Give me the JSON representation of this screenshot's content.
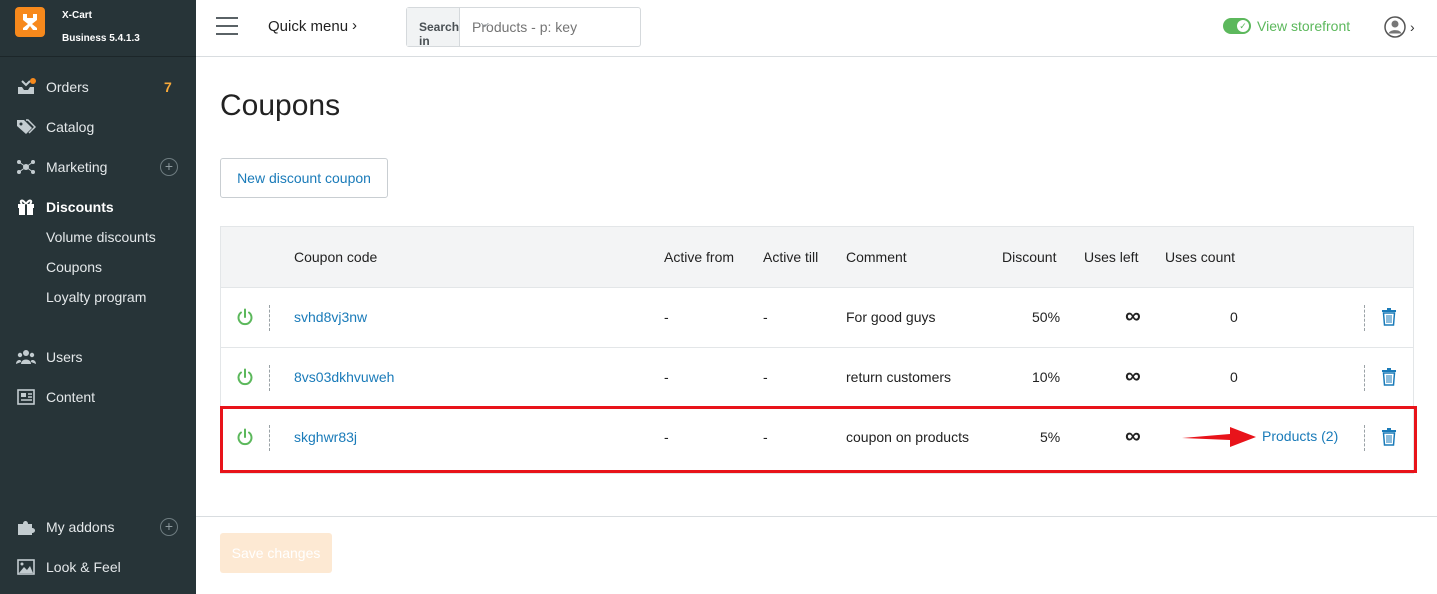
{
  "brand": {
    "name": "X-Cart",
    "version": "Business 5.4.1.3"
  },
  "sidebar": {
    "items": [
      {
        "label": "Orders",
        "badge": "7"
      },
      {
        "label": "Catalog"
      },
      {
        "label": "Marketing",
        "plus": "+"
      },
      {
        "label": "Discounts"
      },
      {
        "label": "Users"
      },
      {
        "label": "Content"
      },
      {
        "label": "My addons",
        "plus": "+"
      },
      {
        "label": "Look & Feel"
      }
    ],
    "sub_items": [
      {
        "label": "Volume discounts"
      },
      {
        "label": "Coupons"
      },
      {
        "label": "Loyalty program"
      }
    ]
  },
  "header": {
    "quick_menu": "Quick menu",
    "quick_menu_chevron": "›",
    "search_in": "Search in",
    "search_in_chevron": "⌵",
    "search_placeholder": "Products - p: key",
    "storefront": "View storefront",
    "user_chevron": "›"
  },
  "page": {
    "title": "Coupons",
    "new_button": "New discount coupon",
    "save_button": "Save changes"
  },
  "table": {
    "columns": [
      "Coupon code",
      "Active from",
      "Active till",
      "Comment",
      "Discount",
      "Uses left",
      "Uses count"
    ],
    "rows": [
      {
        "code": "svhd8vj3nw",
        "active_from": "-",
        "active_till": "-",
        "comment": "For good guys",
        "discount": "50%",
        "uses_left": "∞",
        "uses_count": "0"
      },
      {
        "code": "8vs03dkhvuweh",
        "active_from": "-",
        "active_till": "-",
        "comment": "return customers",
        "discount": "10%",
        "uses_left": "∞",
        "uses_count": "0"
      },
      {
        "code": "skghwr83j",
        "active_from": "-",
        "active_till": "-",
        "comment": "coupon on products",
        "discount": "5%",
        "uses_left": "∞",
        "uses_count": "Products (2)"
      }
    ]
  },
  "colors": {
    "accent": "#1a7bb9",
    "sidebar_bg": "#273438",
    "brand": "#f7891c",
    "highlight": "#e8131a",
    "active_green": "#5cb85c"
  }
}
